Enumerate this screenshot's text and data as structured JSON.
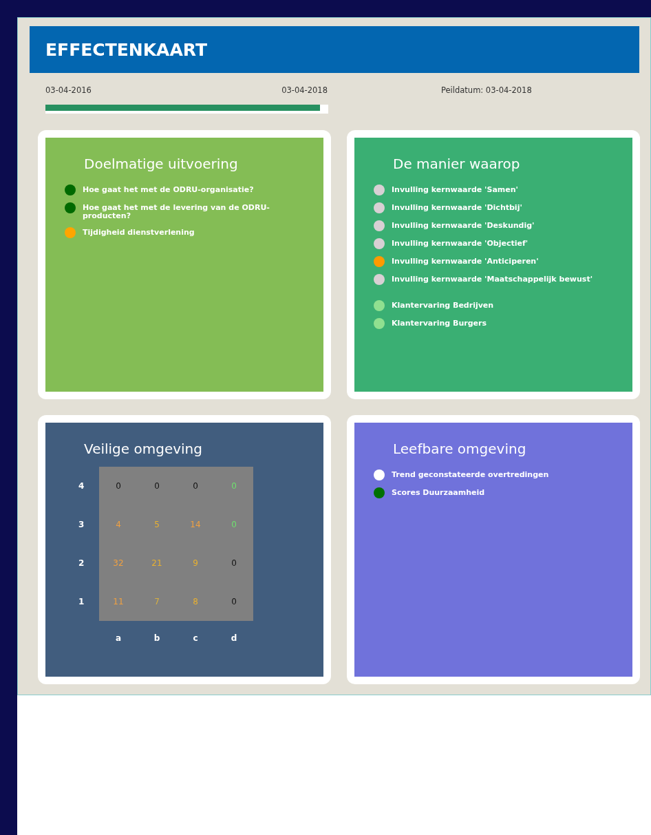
{
  "header": {
    "title": "EFFECTENKAART"
  },
  "timeline": {
    "start": "03-04-2016",
    "end": "03-04-2018",
    "reference": "Peildatum: 03-04-2018",
    "level": 0.97
  },
  "cards": [
    {
      "kind": "list",
      "title": "Doelmatige uitvoering",
      "color": "#84bd55",
      "items": [
        {
          "label": "Hoe gaat het met de ODRU-organisatie?",
          "color": "#006a00"
        },
        {
          "label": "Hoe gaat het met de levering van de ODRU-producten?",
          "color": "#006a00"
        },
        {
          "label": "Tijdigheid dienstverlening",
          "color": "#ffa500"
        }
      ]
    },
    {
      "kind": "list",
      "title": "De manier waarop",
      "color": "#3aaf73",
      "items": [
        {
          "label": "Invulling kernwaarde 'Samen'",
          "color": "#d8d0d4"
        },
        {
          "label": "Invulling kernwaarde 'Dichtbij'",
          "color": "#d8d0d4"
        },
        {
          "label": "Invulling kernwaarde 'Deskundig'",
          "color": "#d8d0d4"
        },
        {
          "label": "Invulling kernwaarde 'Objectief'",
          "color": "#d8d0d4"
        },
        {
          "label": "Invulling kernwaarde 'Anticiperen'",
          "color": "#ff9a00"
        },
        {
          "label": "Invulling kernwaarde 'Maatschappelijk bewust'",
          "color": "#d8d0d4",
          "gap_after": true
        },
        {
          "label": "Klantervaring Bedrijven",
          "color": "#90e090"
        },
        {
          "label": "Klantervaring Burgers",
          "color": "#90e090"
        }
      ]
    },
    {
      "kind": "matrix",
      "title": "Veilige omgeving",
      "color": "#415d7e",
      "row_labels": [
        "4",
        "3",
        "2",
        "1"
      ],
      "column_labels": [
        "a",
        "b",
        "c",
        "d"
      ],
      "rows": [
        [
          {
            "value": "0",
            "color": "#111111"
          },
          {
            "value": "0",
            "color": "#111111"
          },
          {
            "value": "0",
            "color": "#111111"
          },
          {
            "value": "0",
            "color": "#6ee06e"
          }
        ],
        [
          {
            "value": "4",
            "color": "#f0a040"
          },
          {
            "value": "5",
            "color": "#e8b030"
          },
          {
            "value": "14",
            "color": "#f0a040"
          },
          {
            "value": "0",
            "color": "#6ee06e"
          }
        ],
        [
          {
            "value": "32",
            "color": "#f0a040"
          },
          {
            "value": "21",
            "color": "#e8b030"
          },
          {
            "value": "9",
            "color": "#e8b030"
          },
          {
            "value": "0",
            "color": "#111111"
          }
        ],
        [
          {
            "value": "11",
            "color": "#f0a040"
          },
          {
            "value": "7",
            "color": "#d8b040"
          },
          {
            "value": "8",
            "color": "#e8b030"
          },
          {
            "value": "0",
            "color": "#111111"
          }
        ]
      ]
    },
    {
      "kind": "list",
      "title": "Leefbare omgeving",
      "color": "#7072db",
      "items": [
        {
          "label": "Trend geconstateerde overtredingen",
          "color": "#ffffff"
        },
        {
          "label": "Scores Duurzaamheid",
          "color": "#007000"
        }
      ]
    }
  ]
}
